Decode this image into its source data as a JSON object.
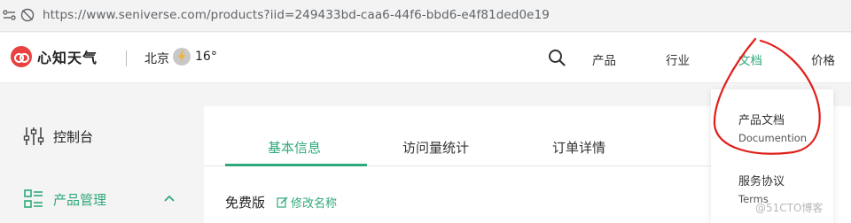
{
  "browser": {
    "url": "https://www.seniverse.com/products?iid=249433bd-caa6-44f6-bbd6-e4f81ded0e19",
    "icons": [
      "site-info-icon",
      "tracking-blocked-icon"
    ]
  },
  "header": {
    "brand": "心知天气",
    "city": "北京",
    "temperature": "16°",
    "weather_icon": "thunder-icon",
    "nav": [
      "产品",
      "行业",
      "文档",
      "价格"
    ],
    "active_nav": "文档"
  },
  "dropdown": {
    "items": [
      {
        "zh": "产品文档",
        "en": "Documention"
      },
      {
        "zh": "服务协议",
        "en": "Terms"
      }
    ]
  },
  "sidebar": {
    "items": [
      {
        "label": "控制台",
        "icon": "sliders-icon"
      },
      {
        "label": "产品管理",
        "icon": "grid-list-icon",
        "active": true
      }
    ]
  },
  "main": {
    "tabs": [
      "基本信息",
      "访问量统计",
      "订单详情"
    ],
    "active_tab": "基本信息",
    "plan": "免费版",
    "rename_label": "修改名称"
  },
  "watermark": "@51CTO博客",
  "colors": {
    "accent": "#2fa97a",
    "brand_red": "#e8413f",
    "annotation_red": "#e0201b"
  }
}
